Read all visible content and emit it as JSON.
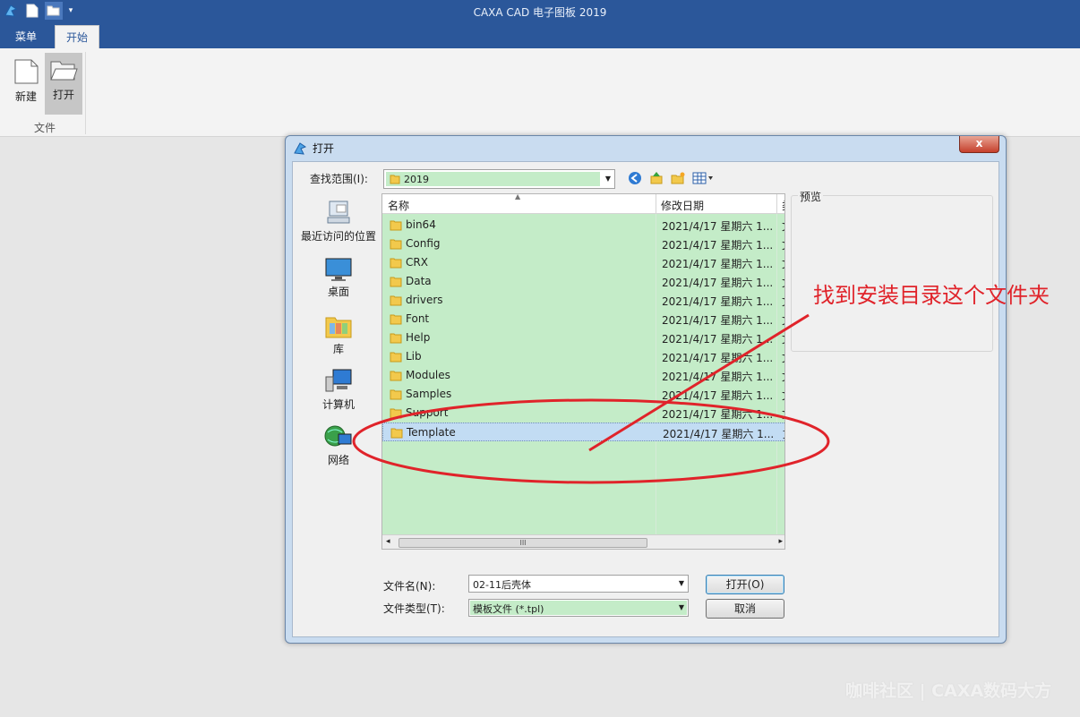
{
  "app": {
    "title": "CAXA CAD 电子图板 2019",
    "quick_access": [
      "new-icon",
      "open-folder-icon",
      "dropdown-icon"
    ]
  },
  "tabs": [
    {
      "label": "菜单",
      "active": false
    },
    {
      "label": "开始",
      "active": true
    }
  ],
  "ribbon": {
    "group_label": "文件",
    "buttons": [
      {
        "label": "新建",
        "icon": "new-document-icon"
      },
      {
        "label": "打开",
        "icon": "open-folder-icon"
      }
    ]
  },
  "dialog": {
    "title": "打开",
    "close_label": "x",
    "look_in_label": "查找范围(I):",
    "look_in_value": "2019",
    "places": [
      {
        "label": "最近访问的位置",
        "icon": "recent-places-icon"
      },
      {
        "label": "桌面",
        "icon": "desktop-icon"
      },
      {
        "label": "库",
        "icon": "libraries-icon"
      },
      {
        "label": "计算机",
        "icon": "computer-icon"
      },
      {
        "label": "网络",
        "icon": "network-icon"
      }
    ],
    "columns": {
      "name": "名称",
      "modified": "修改日期",
      "third": "类"
    },
    "files": [
      {
        "name": "bin64",
        "date": "2021/4/17 星期六 1..."
      },
      {
        "name": "Config",
        "date": "2021/4/17 星期六 1..."
      },
      {
        "name": "CRX",
        "date": "2021/4/17 星期六 1..."
      },
      {
        "name": "Data",
        "date": "2021/4/17 星期六 1..."
      },
      {
        "name": "drivers",
        "date": "2021/4/17 星期六 1..."
      },
      {
        "name": "Font",
        "date": "2021/4/17 星期六 1..."
      },
      {
        "name": "Help",
        "date": "2021/4/17 星期六 1..."
      },
      {
        "name": "Lib",
        "date": "2021/4/17 星期六 1..."
      },
      {
        "name": "Modules",
        "date": "2021/4/17 星期六 1..."
      },
      {
        "name": "Samples",
        "date": "2021/4/17 星期六 1..."
      },
      {
        "name": "Support",
        "date": "2021/4/17 星期六 1..."
      },
      {
        "name": "Template",
        "date": "2021/4/17 星期六 1...",
        "selected": true
      }
    ],
    "preview_label": "预览",
    "file_name_label": "文件名(N):",
    "file_name_value": "02-11后壳体",
    "file_type_label": "文件类型(T):",
    "file_type_value": "模板文件 (*.tpl)",
    "open_button": "打开(O)",
    "cancel_button": "取消",
    "scrollbar_grip": "III"
  },
  "annotation": {
    "text": "找到安装目录这个文件夹",
    "color": "#e0232a"
  },
  "watermark": "咖啡社区 | CAXA数码大方"
}
